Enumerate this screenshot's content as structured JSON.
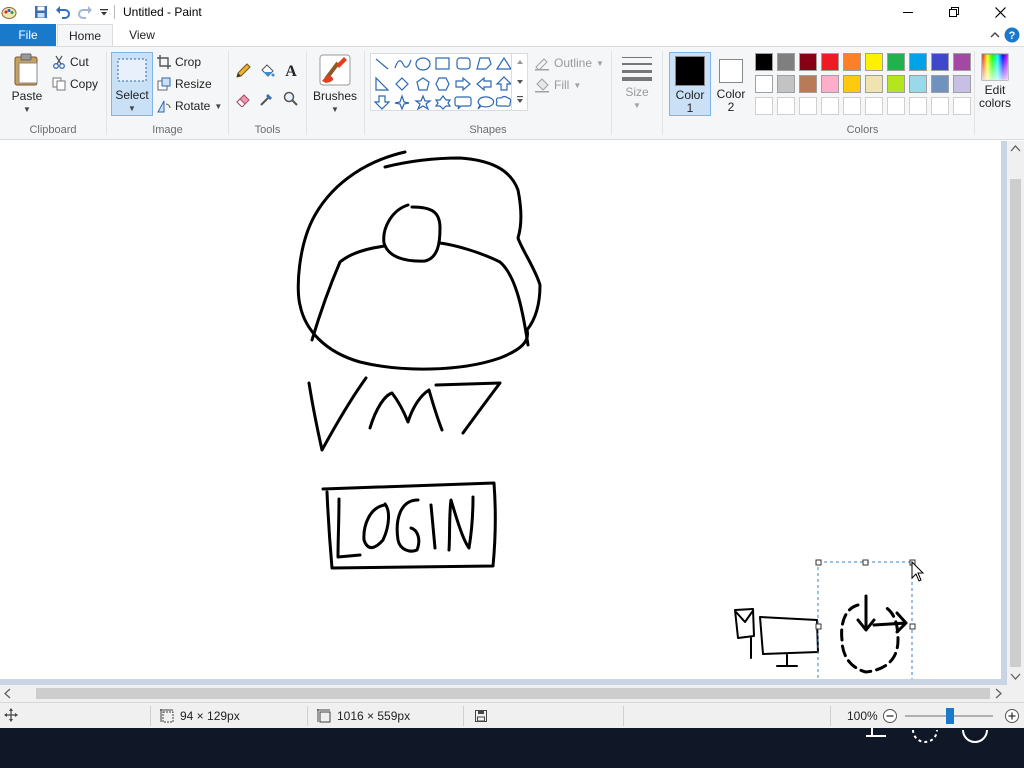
{
  "window": {
    "title": "Untitled - Paint"
  },
  "tabs": {
    "file": "File",
    "home": "Home",
    "view": "View"
  },
  "ribbon": {
    "clipboard": {
      "label": "Clipboard",
      "paste": "Paste",
      "cut": "Cut",
      "copy": "Copy"
    },
    "image": {
      "label": "Image",
      "select": "Select",
      "crop": "Crop",
      "resize": "Resize",
      "rotate": "Rotate"
    },
    "tools": {
      "label": "Tools"
    },
    "brushes": {
      "label": "Brushes"
    },
    "shapes": {
      "label": "Shapes",
      "outline": "Outline",
      "fill": "Fill"
    },
    "size": {
      "label": "Size"
    },
    "color1": {
      "label_line1": "Color",
      "label_line2": "1",
      "value": "#000000"
    },
    "color2": {
      "label_line1": "Color",
      "label_line2": "2",
      "value": "#ffffff"
    },
    "colors": {
      "label": "Colors",
      "edit_line1": "Edit",
      "edit_line2": "colors",
      "palette_row1": [
        "#000000",
        "#7f7f7f",
        "#880015",
        "#ed1c24",
        "#ff7f27",
        "#fff200",
        "#22b14c",
        "#00a2e8",
        "#3f48cc",
        "#a349a4"
      ],
      "palette_row2": [
        "#ffffff",
        "#c3c3c3",
        "#b97a57",
        "#ffaec9",
        "#ffc90e",
        "#efe4b0",
        "#b5e61d",
        "#99d9ea",
        "#7092be",
        "#c8bfe7"
      ]
    }
  },
  "status": {
    "selection_size": "94 × 129px",
    "image_size": "1016 × 559px",
    "zoom": "100%"
  }
}
